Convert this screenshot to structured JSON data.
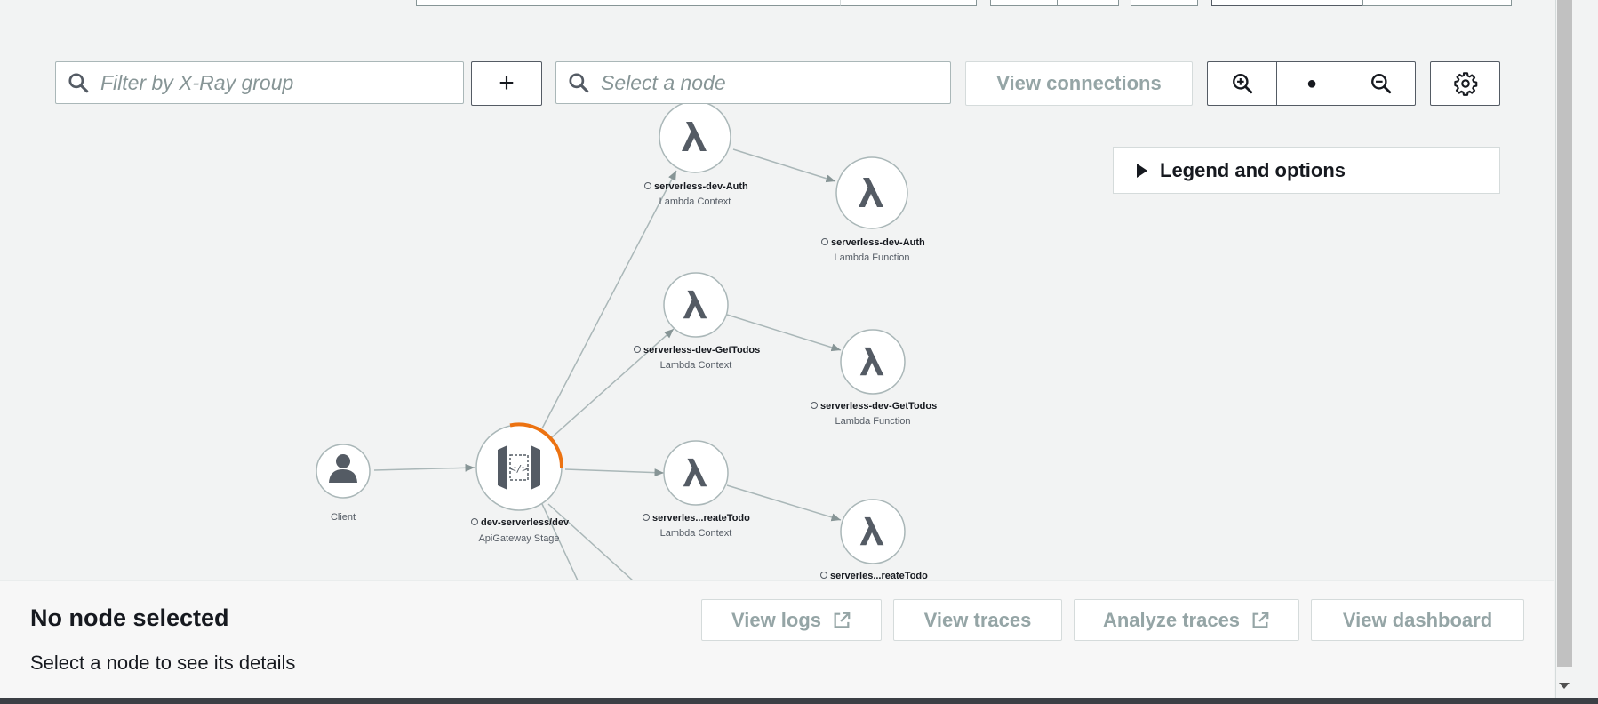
{
  "toolbar": {
    "group_filter_placeholder": "Filter by X-Ray group",
    "add_group_label": "+",
    "node_search_placeholder": "Select a node",
    "view_connections_label": "View connections",
    "zoom_reset_label": "●",
    "legend_label": "Legend and options"
  },
  "graph": {
    "nodes": [
      {
        "id": "client",
        "name": "Client",
        "type": ""
      },
      {
        "id": "apigw",
        "name": "dev-serverless/dev",
        "type": "ApiGateway Stage"
      },
      {
        "id": "auth_ctx",
        "name": "serverless-dev-Auth",
        "type": "Lambda Context"
      },
      {
        "id": "auth_fn",
        "name": "serverless-dev-Auth",
        "type": "Lambda Function"
      },
      {
        "id": "get_ctx",
        "name": "serverless-dev-GetTodos",
        "type": "Lambda Context"
      },
      {
        "id": "get_fn",
        "name": "serverless-dev-GetTodos",
        "type": "Lambda Function"
      },
      {
        "id": "create_ctx",
        "name": "serverles...reateTodo",
        "type": "Lambda Context"
      },
      {
        "id": "create_fn",
        "name": "serverles...reateTodo",
        "type": ""
      }
    ],
    "edges": [
      [
        "client",
        "apigw"
      ],
      [
        "apigw",
        "auth_ctx"
      ],
      [
        "auth_ctx",
        "auth_fn"
      ],
      [
        "apigw",
        "get_ctx"
      ],
      [
        "get_ctx",
        "get_fn"
      ],
      [
        "apigw",
        "create_ctx"
      ],
      [
        "create_ctx",
        "create_fn"
      ]
    ]
  },
  "details": {
    "title": "No node selected",
    "description": "Select a node to see its details",
    "view_logs_label": "View logs",
    "view_traces_label": "View traces",
    "analyze_traces_label": "Analyze traces",
    "view_dashboard_label": "View dashboard"
  },
  "colors": {
    "accent_error_arc": "#ec7211",
    "icon_grey": "#545b64",
    "disabled_text": "#95a5a6"
  }
}
